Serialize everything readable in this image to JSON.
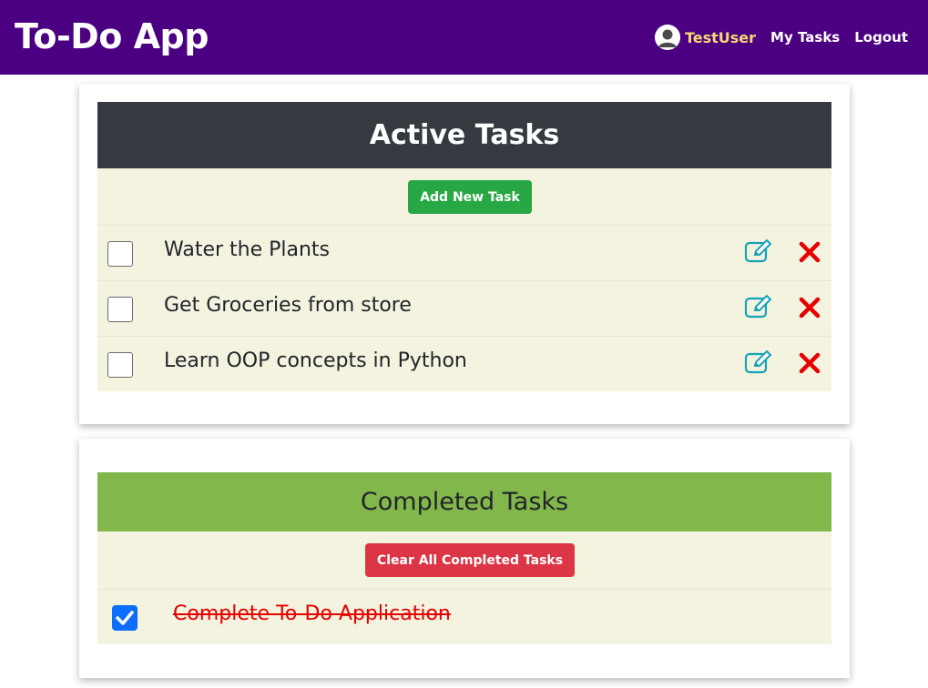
{
  "navbar": {
    "brand": "To-Do App",
    "user_icon": "user-circle-icon",
    "username": "TestUser",
    "links": [
      "My Tasks",
      "Logout"
    ]
  },
  "active": {
    "title": "Active Tasks",
    "add_button": "Add New Task",
    "tasks": [
      {
        "text": "Water the Plants",
        "checked": false
      },
      {
        "text": "Get Groceries from store",
        "checked": false
      },
      {
        "text": "Learn OOP concepts in Python",
        "checked": false
      }
    ],
    "edit_icon": "edit-icon",
    "delete_icon": "delete-x-icon"
  },
  "completed": {
    "title": "Completed Tasks",
    "clear_button": "Clear All Completed Tasks",
    "tasks": [
      {
        "text": "Complete To-Do Application",
        "checked": true
      }
    ]
  },
  "colors": {
    "navbar": "#4b0082",
    "username": "#f7d774",
    "active_header": "#343a40",
    "completed_header": "#82b74b",
    "row_bg": "#f3f3df",
    "add_button": "#28a745",
    "clear_button": "#dc3545",
    "edit": "#17a2b8",
    "delete": "#e60000",
    "done_text": "#e60000",
    "checkbox_checked": "#0d6efd"
  }
}
